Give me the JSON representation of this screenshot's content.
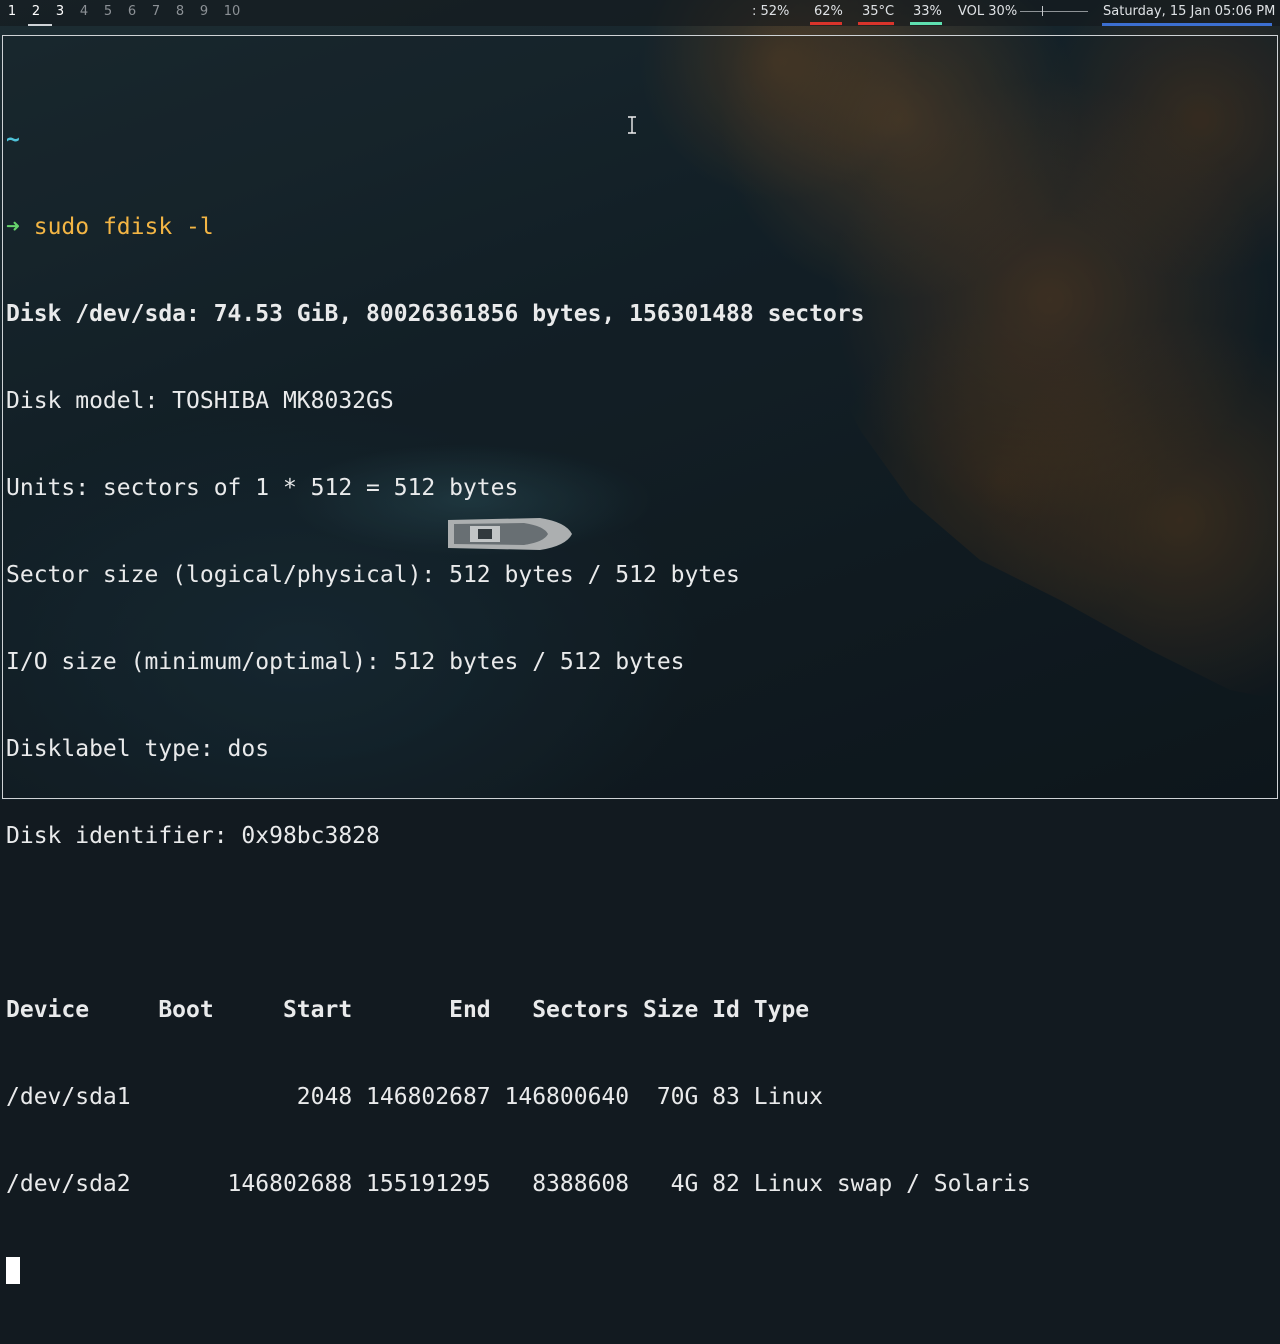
{
  "topbar": {
    "workspaces": [
      "1",
      "2",
      "3",
      "4",
      "5",
      "6",
      "7",
      "8",
      "9",
      "10"
    ],
    "active_workspace": "2",
    "status": {
      "cpu": ": 52%",
      "mem": "62%",
      "temp": "35°C",
      "disk": "33%",
      "volume": "VOL 30%",
      "volume_level": 0.3,
      "datetime": "Saturday, 15 Jan 05:06 PM"
    },
    "colors": {
      "mem_line": "#d9342b",
      "temp_line": "#d9342b",
      "disk_line": "#5fe0b0",
      "date_line": "#3c6fd1"
    }
  },
  "terminal": {
    "prompt_dir": "~",
    "prompt_arrow": "➜",
    "command": "sudo fdisk -l",
    "lines": [
      "Disk /dev/sda: 74.53 GiB, 80026361856 bytes, 156301488 sectors",
      "Disk model: TOSHIBA MK8032GS",
      "Units: sectors of 1 * 512 = 512 bytes",
      "Sector size (logical/physical): 512 bytes / 512 bytes",
      "I/O size (minimum/optimal): 512 bytes / 512 bytes",
      "Disklabel type: dos",
      "Disk identifier: 0x98bc3828",
      "",
      "Device     Boot     Start       End   Sectors Size Id Type",
      "/dev/sda1            2048 146802687 146800640  70G 83 Linux",
      "/dev/sda2       146802688 155191295   8388608   4G 82 Linux swap / Solaris"
    ],
    "colors": {
      "text": "#e9eaeb",
      "tilde": "#4fc2d8",
      "arrow": "#67d36c",
      "command": "#f3b544"
    }
  }
}
